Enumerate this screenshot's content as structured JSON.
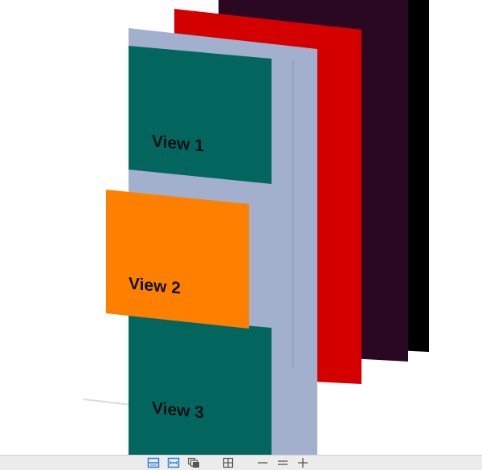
{
  "scene": {
    "colors": {
      "background_black": "#000000",
      "background_dark": "#2a0822",
      "background_red": "#d40000",
      "container_blue": "#a2b0ce",
      "view_teal": "#02665f",
      "view_orange": "#ff8000",
      "label_text": "#111111"
    },
    "views": [
      {
        "label": "View 1"
      },
      {
        "label": "View 2"
      },
      {
        "label": "View 3"
      }
    ]
  },
  "toolbar": {
    "accent_color": "#2f7fd6",
    "buttons": [
      {
        "icon": "clip-content-icon",
        "active": true
      },
      {
        "icon": "show-constraints-icon",
        "active": true
      },
      {
        "icon": "layers-icon",
        "active": false
      },
      {
        "icon": "grid-icon",
        "active": false
      },
      {
        "icon": "zoom-out-icon",
        "active": false
      },
      {
        "icon": "zoom-actual-size-icon",
        "active": false
      },
      {
        "icon": "zoom-in-icon",
        "active": false
      }
    ]
  }
}
